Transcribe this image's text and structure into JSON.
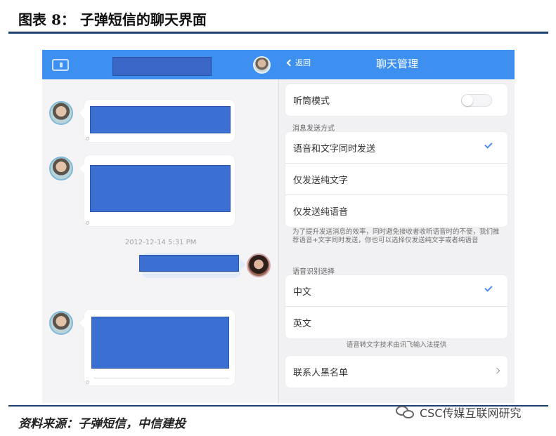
{
  "figure": {
    "title": "图表 8： 子弹短信的聊天界面",
    "source": "资料来源：子弹短信，中信建投",
    "watermark": "CSC传媒互联网研究"
  },
  "chat": {
    "timestamp": "2012-12-14 5:31 PM"
  },
  "settings": {
    "back_label": "返回",
    "title": "聊天管理",
    "listen_mode_label": "听筒模式",
    "listen_mode_on": false,
    "send_method_header": "消息发送方式",
    "send_options": [
      {
        "label": "语音和文字同时发送",
        "selected": true
      },
      {
        "label": "仅发送纯文字",
        "selected": false
      },
      {
        "label": "仅发送纯语音",
        "selected": false
      }
    ],
    "send_note": "为了提升发送消息的效率，同时避免接收者收听语音时的不便，我们推荐语音+文字同时发送，你也可以选择仅发送纯文字或者纯语音",
    "recognition_header": "语音识别选择",
    "languages": [
      {
        "label": "中文",
        "selected": true
      },
      {
        "label": "英文",
        "selected": false
      }
    ],
    "recognition_note": "语音转文字技术由讯飞输入法提供",
    "blacklist_label": "联系人黑名单"
  },
  "colors": {
    "header_blue": "#3d8ff0",
    "redaction_blue": "#3b6fd1",
    "rule_navy": "#1f3f6e",
    "check_blue": "#4a8ee8"
  }
}
